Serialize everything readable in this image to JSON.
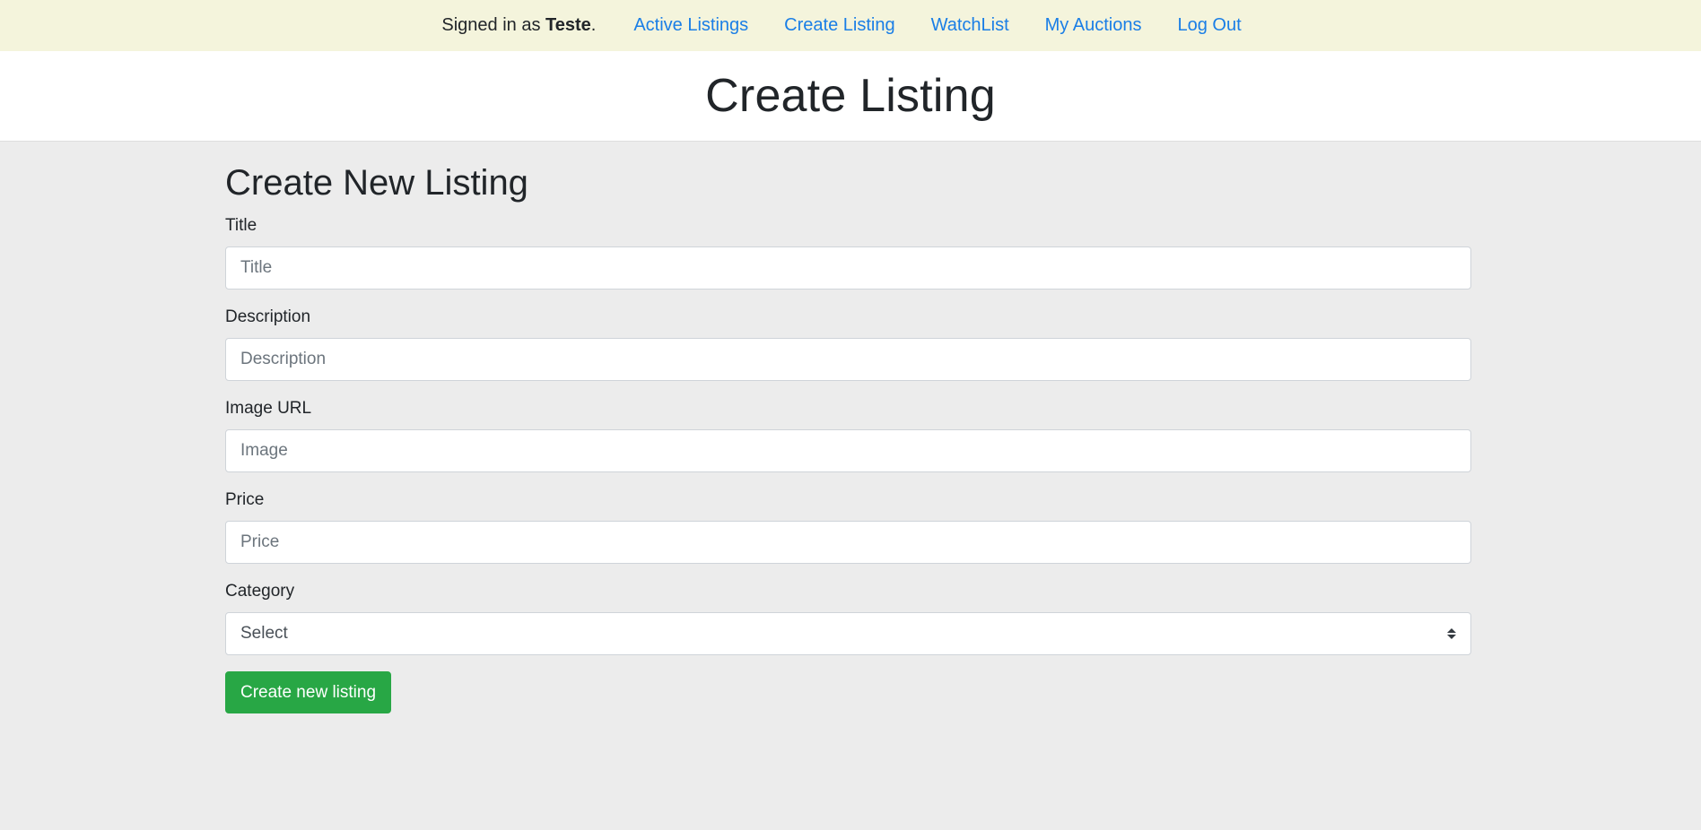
{
  "topbar": {
    "signed_in_prefix": "Signed in as ",
    "username": "Teste",
    "signed_in_suffix": ".",
    "links": {
      "active_listings": "Active Listings",
      "create_listing": "Create Listing",
      "watchlist": "WatchList",
      "my_auctions": "My Auctions",
      "log_out": "Log Out"
    }
  },
  "header": {
    "title": "Create Listing"
  },
  "form": {
    "heading": "Create New Listing",
    "title_label": "Title",
    "title_placeholder": "Title",
    "description_label": "Description",
    "description_placeholder": "Description",
    "image_label": "Image URL",
    "image_placeholder": "Image",
    "price_label": "Price",
    "price_placeholder": "Price",
    "category_label": "Category",
    "category_selected": "Select",
    "submit_label": "Create new listing"
  },
  "colors": {
    "topbar_bg": "#f4f4dc",
    "link": "#1a7ee6",
    "page_bg": "#ececec",
    "submit_button": "#28a745"
  }
}
